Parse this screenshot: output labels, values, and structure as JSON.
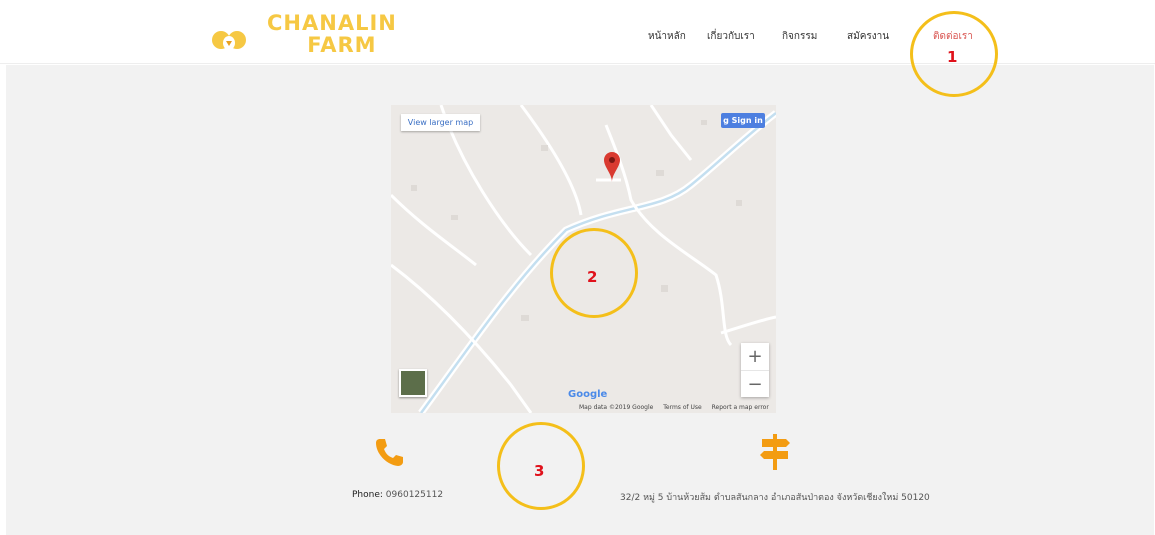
{
  "brand": {
    "line1": "CHANALIN",
    "line2": "FARM"
  },
  "nav": {
    "items": [
      {
        "label": "หน้าหลัก"
      },
      {
        "label": "เกี่ยวกับเรา"
      },
      {
        "label": "กิจกรรม"
      },
      {
        "label": "สมัครงาน"
      },
      {
        "label": "ติดต่อเรา",
        "active": true
      }
    ]
  },
  "map": {
    "view_larger": "View larger map",
    "sign_in": "Sign in",
    "zoom_in": "+",
    "zoom_out": "−",
    "google_logo": "Google",
    "map_data": "Map data ©2019 Google",
    "terms": "Terms of Use",
    "report": "Report a map error"
  },
  "contact": {
    "phone_label": "Phone:",
    "phone_value": "0960125112",
    "address": "32/2 หมู่ 5 บ้านห้วยส้ม ตำบลสันกลาง อำเภอสันป่าตอง จังหวัดเชียงใหม่ 50120"
  },
  "annotations": [
    "1",
    "2",
    "3"
  ],
  "colors": {
    "accent": "#f6c843",
    "nav_active": "#d9534f",
    "icon_orange": "#f39c12",
    "ring": "#f4bf1a",
    "ring_number": "#e0111b"
  }
}
